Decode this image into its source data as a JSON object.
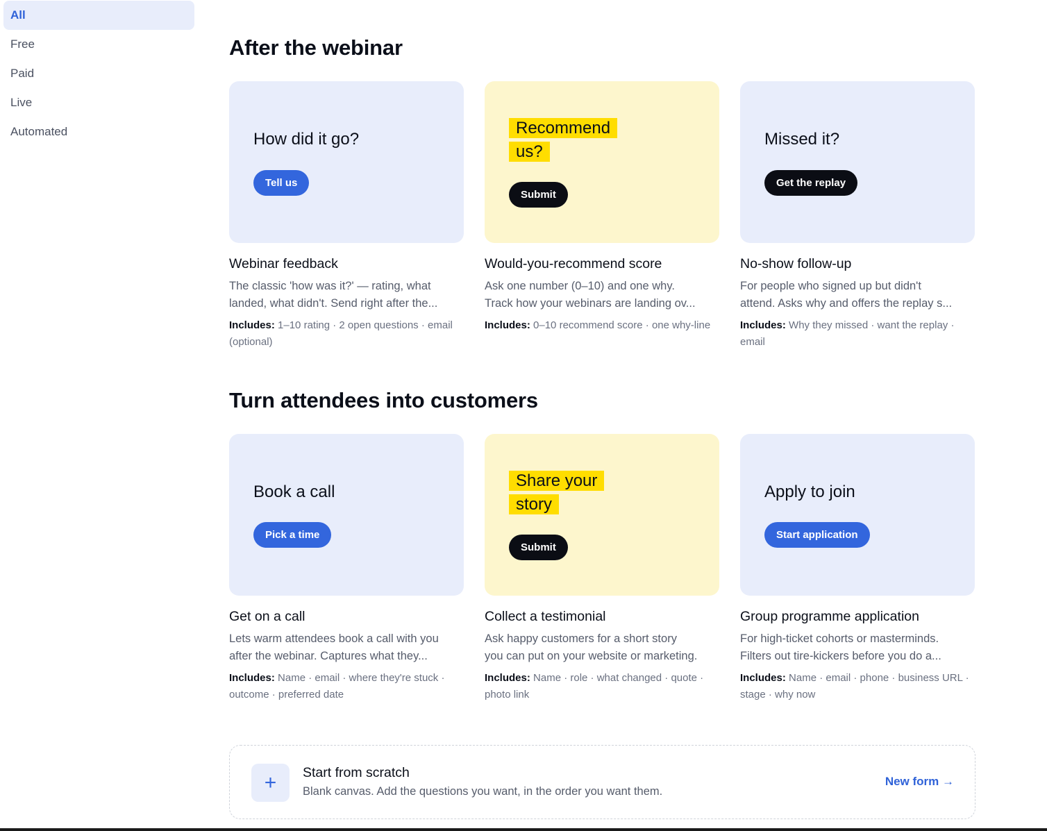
{
  "sidebar": {
    "items": [
      {
        "label": "All",
        "active": true
      },
      {
        "label": "Free"
      },
      {
        "label": "Paid"
      },
      {
        "label": "Live"
      },
      {
        "label": "Automated"
      }
    ]
  },
  "sections": [
    {
      "title": "After the webinar",
      "cards": [
        {
          "preview_question": "How did it go?",
          "button": "Tell us",
          "title": "Webinar feedback",
          "desc1": "The classic 'how was it?' — rating, what",
          "desc2": "landed, what didn't. Send right after the...",
          "includes_label": "Includes:",
          "includes": "1–10 rating · 2 open questions · email (optional)"
        },
        {
          "preview_question": "Recommend us?",
          "button": "Submit",
          "title": "Would-you-recommend score",
          "desc1": "Ask one number (0–10) and one why.",
          "desc2": "Track how your webinars are landing ov...",
          "includes_label": "Includes:",
          "includes": "0–10 recommend score · one why-line"
        },
        {
          "preview_question": "Missed it?",
          "button": "Get the replay",
          "title": "No-show follow-up",
          "desc1": "For people who signed up but didn't",
          "desc2": "attend. Asks why and offers the replay s...",
          "includes_label": "Includes:",
          "includes": "Why they missed · want the replay · email"
        }
      ]
    },
    {
      "title": "Turn attendees into customers",
      "cards": [
        {
          "preview_question": "Book a call",
          "button": "Pick a time",
          "title": "Get on a call",
          "desc1": "Lets warm attendees book a call with you",
          "desc2": "after the webinar. Captures what they...",
          "includes_label": "Includes:",
          "includes": "Name · email · where they're stuck · outcome · preferred date"
        },
        {
          "preview_question": "Share your story",
          "button": "Submit",
          "title": "Collect a testimonial",
          "desc1": "Ask happy customers for a short story",
          "desc2": "you can put on your website or marketing.",
          "includes_label": "Includes:",
          "includes": "Name · role · what changed · quote · photo link"
        },
        {
          "preview_question": "Apply to join",
          "button": "Start application",
          "title": "Group programme application",
          "desc1": "For high-ticket cohorts or masterminds.",
          "desc2": "Filters out tire-kickers before you do a...",
          "includes_label": "Includes:",
          "includes": "Name · email · phone · business URL · stage · why now"
        }
      ]
    }
  ],
  "scratch": {
    "icon": "plus-icon",
    "plus": "+",
    "title": "Start from scratch",
    "desc": "Blank canvas. Add the questions you want, in the order you want them.",
    "link": "New form →"
  },
  "colors": {
    "accent": "#3366dd",
    "highlight": "#ffdd00",
    "preview_blue": "#e8edfb",
    "preview_yellow": "#fdf6cd"
  }
}
